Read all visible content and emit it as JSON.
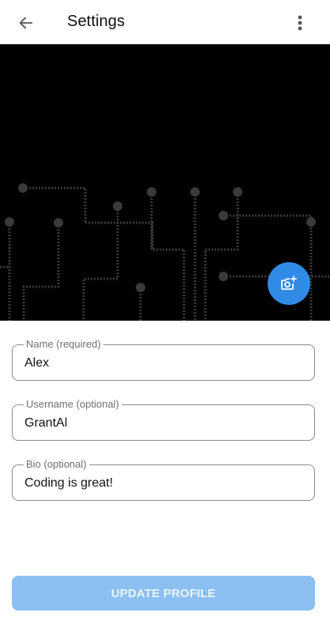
{
  "appbar": {
    "title": "Settings",
    "back_icon": "arrow-left-icon",
    "menu_icon": "more-vert-icon"
  },
  "cover": {
    "image": "circuit-board-pattern",
    "change_photo_icon": "add-photo-camera-icon"
  },
  "form": {
    "name": {
      "label": "Name (required)",
      "value": "Alex"
    },
    "username": {
      "label": "Username (optional)",
      "value": "GrantAl"
    },
    "bio": {
      "label": "Bio (optional)",
      "value": "Coding is great!"
    }
  },
  "actions": {
    "update_label": "UPDATE PROFILE"
  },
  "colors": {
    "accent": "#2f8be6",
    "button_disabled": "#8cc0f2",
    "cover_bg": "#000000",
    "circuit": "#3a3a3a"
  }
}
